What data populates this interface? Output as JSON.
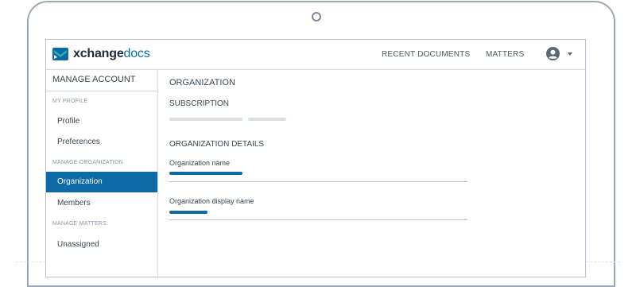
{
  "app": {
    "logo": {
      "brand_part1": "xchange",
      "brand_part2": "docs",
      "mark_icon": "xchangedocs-logo-icon"
    },
    "nav": {
      "recent_documents": "RECENT DOCUMENTS",
      "matters": "MATTERS"
    },
    "user_menu": {
      "avatar_icon": "user-circle-icon",
      "dropdown_icon": "caret-down-icon"
    }
  },
  "sidebar": {
    "title": "MANAGE ACCOUNT",
    "sections": [
      {
        "label": "MY PROFILE"
      },
      {
        "label": "MANAGE ORGANIZATION"
      },
      {
        "label": "MANAGE MATTERS"
      }
    ],
    "items": [
      {
        "label": "Profile",
        "active": false
      },
      {
        "label": "Preferences",
        "active": false
      },
      {
        "label": "Organization",
        "active": true
      },
      {
        "label": "Members",
        "active": false
      },
      {
        "label": "Unassigned",
        "active": false
      }
    ]
  },
  "main": {
    "title": "ORGANIZATION",
    "subscription": {
      "heading": "SUBSCRIPTION",
      "loading": true
    },
    "details": {
      "heading": "ORGANIZATION DETAILS",
      "fields": [
        {
          "label": "Organization name"
        },
        {
          "label": "Organization display name"
        }
      ]
    }
  },
  "colors": {
    "accent": "#0d6aa6",
    "frame": "#9aa7b4",
    "text": "#3b4651",
    "muted": "#8b96a1",
    "skeleton": "#d9dfe6"
  }
}
